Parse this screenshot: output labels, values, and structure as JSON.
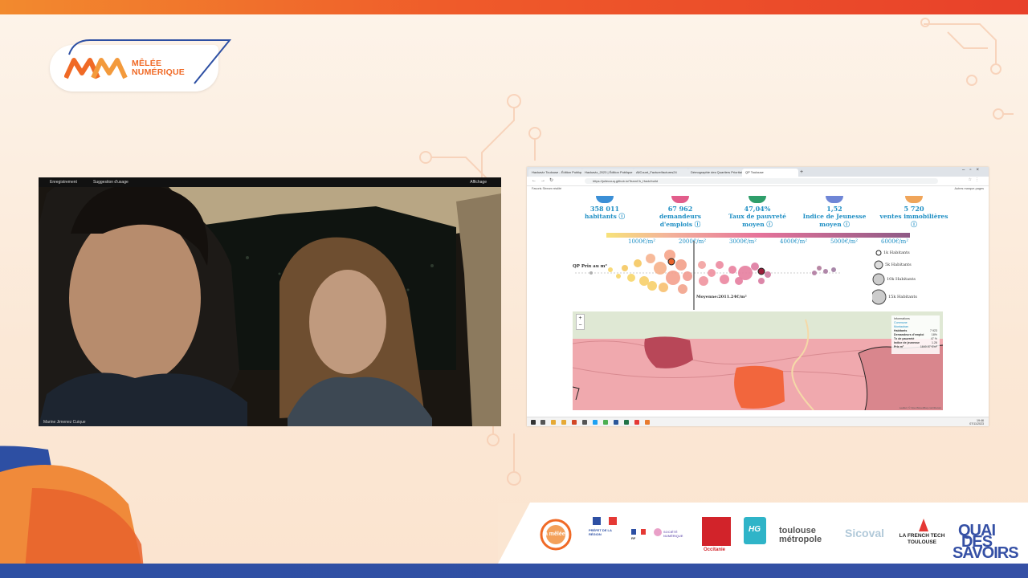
{
  "event": {
    "logo_line1": "MÊLÉE",
    "logo_line2": "NUMÉRIQUE"
  },
  "webcam": {
    "top_left_label": "Enregistrement",
    "top_mid_label": "Suggestion d'usage",
    "top_right_label": "Affichage",
    "bottom_label": "Marine Jimenez Cuique"
  },
  "browser": {
    "tabs": [
      {
        "label": "Hackaviz Toulouse - Édition Publique"
      },
      {
        "label": "Hackaviz_2023 | Édition Publique"
      },
      {
        "label": "AllCount_Facture/factures24"
      },
      {
        "label": "Démographie des Quartiers Prioritaires"
      },
      {
        "label": "QP Toulouse"
      }
    ],
    "url": "https://juliecouq.github.io/TeamCh_Hack/build",
    "bookmark_left": "Favoris Stream réalité",
    "bookmark_right": "Autres marque-pages"
  },
  "kpis": [
    {
      "value": "358 011",
      "label1": "habitants",
      "label2": "",
      "color": "#3b8fd6"
    },
    {
      "value": "67 962",
      "label1": "demandeurs",
      "label2": "d'emplois",
      "color": "#e25d8b"
    },
    {
      "value": "47,04%",
      "label1": "Taux de pauvreté",
      "label2": "moyen",
      "color": "#2e9e6a"
    },
    {
      "value": "1,52",
      "label1": "Indice de Jeunesse",
      "label2": "moyen",
      "color": "#6f86d6"
    },
    {
      "value": "5 720",
      "label1": "ventes immobilières",
      "label2": "",
      "color": "#f0a55a"
    }
  ],
  "scale_ticks": [
    "1000€/m²",
    "2000€/m²",
    "3000€/m²",
    "4000€/m²",
    "5000€/m²",
    "6000€/m²"
  ],
  "qp_label": "QP   Prix au m²",
  "moyenne_label": "Moyenne:2011.24€/m²",
  "size_legend": [
    "1k Habitants",
    "5k Habitants",
    "10k Habitants",
    "15k Habitants"
  ],
  "map": {
    "zoom_in": "+",
    "zoom_out": "−",
    "info_title": "Informations",
    "info_commune": "Commune",
    "info_commune_value": "Montauban",
    "info_rows": [
      {
        "k": "Habitants",
        "v": "7 923"
      },
      {
        "k": "Demandeurs d'emploi",
        "v": "18%"
      },
      {
        "k": "Tx de pauvreté",
        "v": "47 %"
      },
      {
        "k": "Indice de jeunesse",
        "v": "1.26"
      },
      {
        "k": "Prix m²",
        "v": "1840.57 €/m²"
      }
    ],
    "attribution": "Leaflet | © OpenStreetMap contributors"
  },
  "taskbar": {
    "time": "19:46",
    "date": "07/11/2023"
  },
  "sponsors": [
    {
      "name": "la mêlée"
    },
    {
      "name": "PRÉFET DE LA RÉGION"
    },
    {
      "name": "RF"
    },
    {
      "name": "SOCIÉTÉ NUMÉRIQUE"
    },
    {
      "name": "Occitanie"
    },
    {
      "name": "HG"
    },
    {
      "name": "toulouse métropole"
    },
    {
      "name": "Sicoval"
    },
    {
      "name": "LA FRENCH TECH TOULOUSE"
    },
    {
      "name": "QUAI DES SAVOIRS"
    }
  ],
  "colors": {
    "brand_orange": "#f06a26",
    "brand_blue": "#2d4fa3",
    "kpi_blue": "#1f8fc4"
  }
}
